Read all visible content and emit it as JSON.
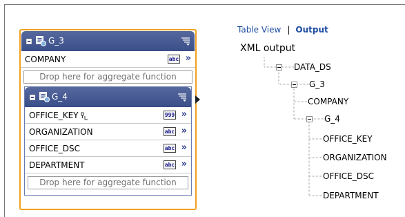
{
  "model": {
    "g3": {
      "title": "G_3",
      "fields": [
        {
          "label": "COMPANY",
          "type": "abc"
        }
      ],
      "drop_text": "Drop here for aggregate function"
    },
    "g4": {
      "title": "G_4",
      "fields": [
        {
          "label": "OFFICE_KEY",
          "type": "999"
        },
        {
          "label": "ORGANIZATION",
          "type": "abc"
        },
        {
          "label": "OFFICE_DSC",
          "type": "abc"
        },
        {
          "label": "DEPARTMENT",
          "type": "abc"
        }
      ],
      "drop_text": "Drop here for aggregate function"
    },
    "expand_glyph": "»",
    "accent_color": "#f0a020",
    "header_color": "#3a4e88"
  },
  "view_tabs": {
    "table_view": "Table View",
    "separator": "|",
    "output": "Output"
  },
  "xml_output": {
    "title": "XML output",
    "root": "DATA_DS",
    "group": "G_3",
    "company": "COMPANY",
    "subgroup": "G_4",
    "leaves": [
      "OFFICE_KEY",
      "ORGANIZATION",
      "OFFICE_DSC",
      "DEPARTMENT"
    ]
  }
}
